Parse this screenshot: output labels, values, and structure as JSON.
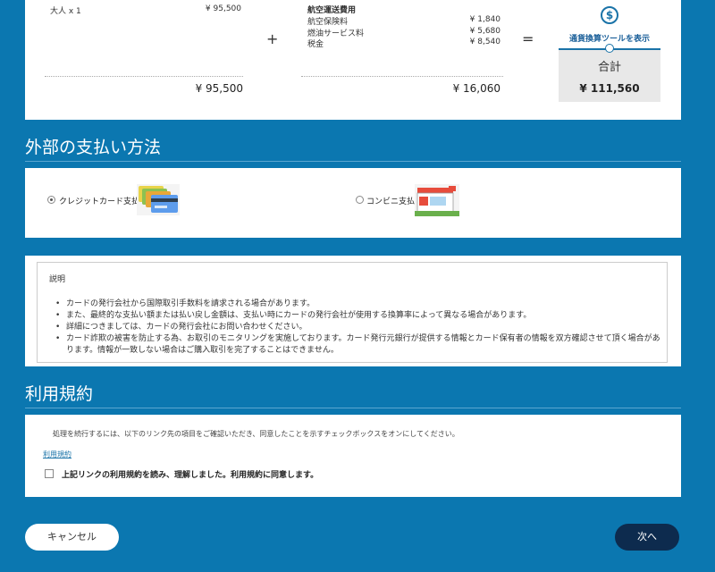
{
  "fare": {
    "adult_label": "大人 x 1",
    "adult_value": "¥ 95,500",
    "adult_subtotal": "¥ 95,500",
    "plus": "+",
    "equals": "=",
    "surcharge_title": "航空運送費用",
    "items": [
      {
        "label": "航空保険料",
        "value": "¥ 1,840"
      },
      {
        "label": "燃油サービス料",
        "value": "¥ 5,680"
      },
      {
        "label": "税金",
        "value": "¥ 8,540"
      }
    ],
    "surcharge_subtotal": "¥ 16,060",
    "currency_tool_label": "通貨換算ツールを表示",
    "total_label": "合計",
    "total_value": "¥ 111,560"
  },
  "payment": {
    "title": "外部の支払い方法",
    "options": [
      {
        "label": "クレジットカード支払",
        "selected": true,
        "icon": "credit-cards-icon"
      },
      {
        "label": "コンビニ支払",
        "selected": false,
        "icon": "convenience-store-icon"
      }
    ]
  },
  "description": {
    "title": "説明",
    "items": [
      "カードの発行会社から国際取引手数料を請求される場合があります。",
      "また、最終的な支払い額または払い戻し金額は、支払い時にカードの発行会社が使用する換算率によって異なる場合があります。",
      "詳細につきましては、カードの発行会社にお問い合わせください。",
      "カード詐欺の被害を防止する為、お取引のモニタリングを実施しております。カード発行元銀行が提供する情報とカード保有者の情報を双方確認させて頂く場合があります。情報が一致しない場合はご購入取引を完了することはできません。"
    ]
  },
  "terms": {
    "title": "利用規約",
    "note": "処理を続行するには、以下のリンク先の項目をご確認いただき、同意したことを示すチェックボックスをオンにしてください。",
    "link": "利用規約",
    "agree_label": "上記リンクの利用規約を読み、理解しました。利用規約に同意します。"
  },
  "buttons": {
    "cancel": "キャンセル",
    "next": "次へ"
  },
  "colors": {
    "background": "#0b77b0",
    "next_button": "#0d2b4e",
    "accent": "#1a73a8"
  }
}
